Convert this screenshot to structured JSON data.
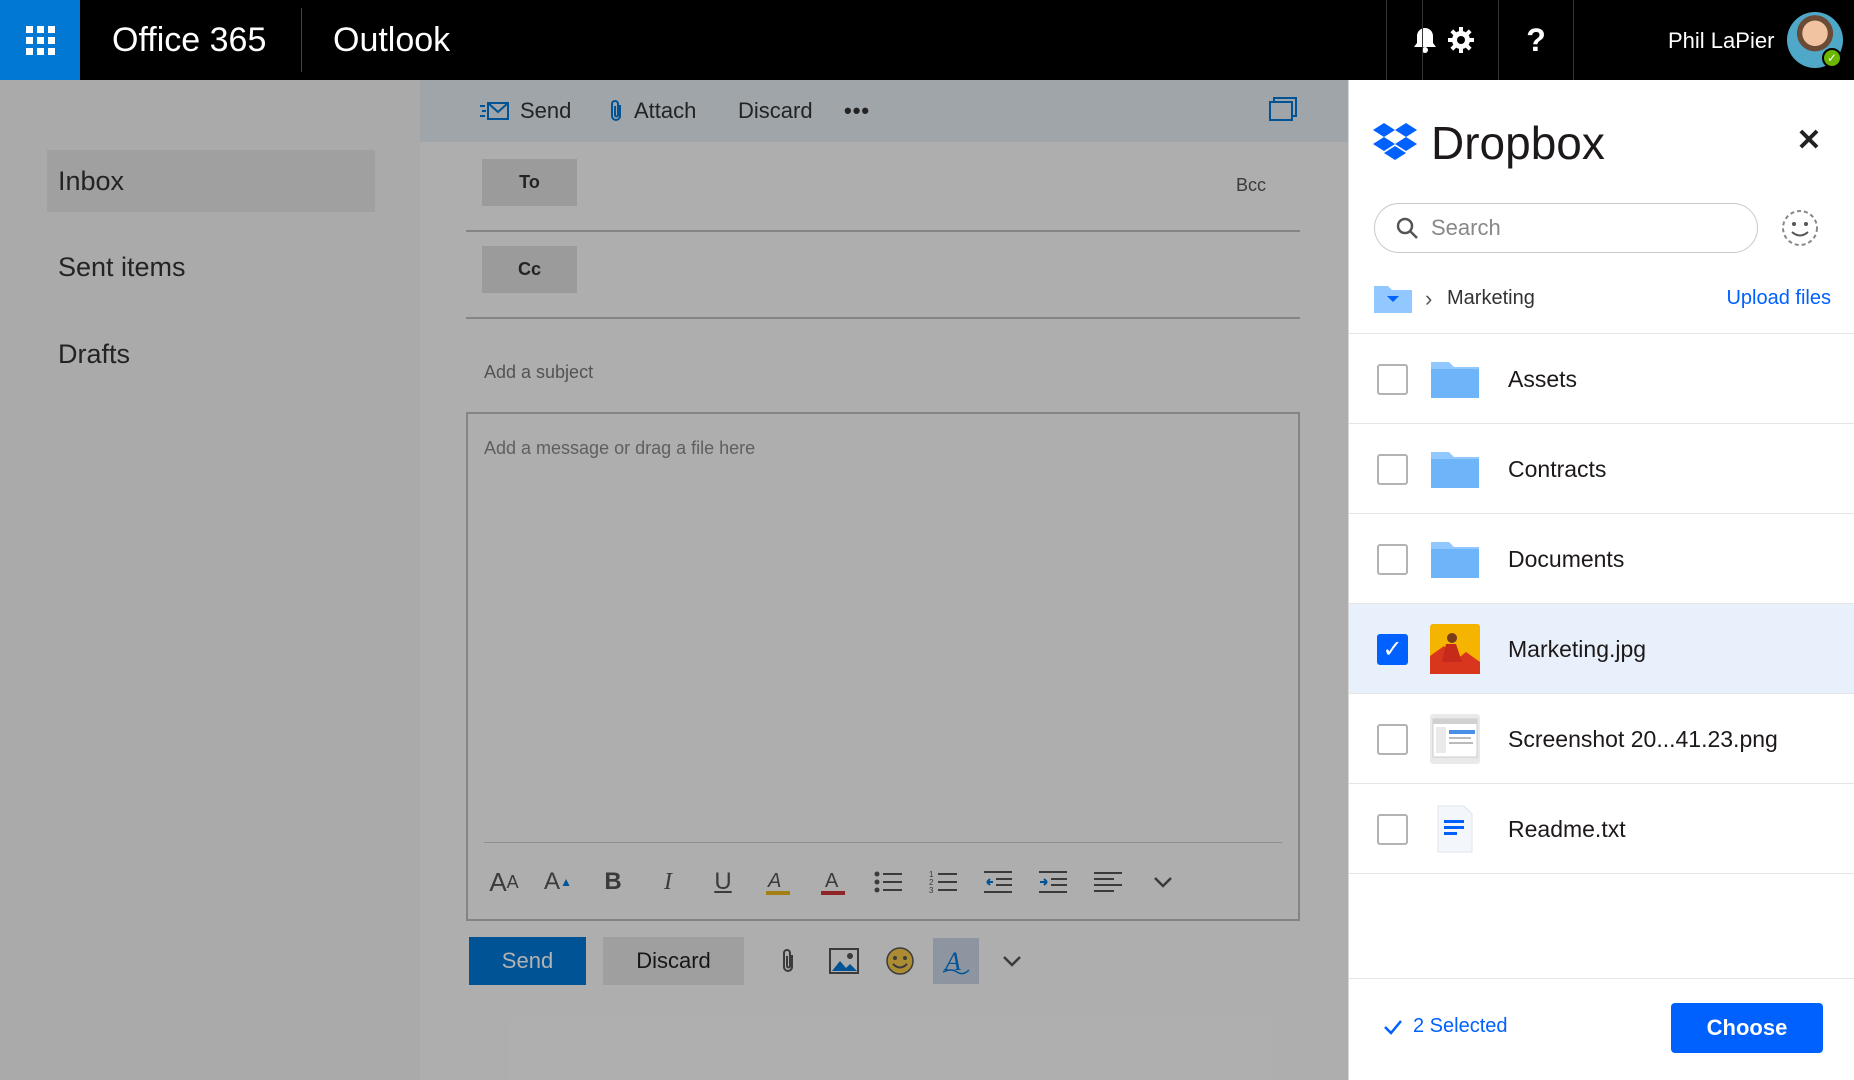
{
  "topbar": {
    "brand": "Office 365",
    "app": "Outlook",
    "user_name": "Phil LaPier",
    "icons": [
      "app-launcher-icon",
      "bell-icon",
      "gear-icon",
      "help-icon"
    ]
  },
  "nav": {
    "items": [
      {
        "label": "Inbox",
        "active": true
      },
      {
        "label": "Sent items",
        "active": false
      },
      {
        "label": "Drafts",
        "active": false
      }
    ]
  },
  "compose": {
    "toolbar": {
      "send": "Send",
      "attach": "Attach",
      "discard": "Discard",
      "more": "•••"
    },
    "to_label": "To",
    "cc_label": "Cc",
    "bcc_label": "Bcc",
    "subject_placeholder": "Add a subject",
    "body_placeholder": "Add a message or drag a file here",
    "send_button": "Send",
    "discard_button": "Discard"
  },
  "dropbox": {
    "title": "Dropbox",
    "search_placeholder": "Search",
    "breadcrumb": "Marketing",
    "upload_label": "Upload files",
    "files": [
      {
        "name": "Assets",
        "kind": "folder",
        "checked": false
      },
      {
        "name": "Contracts",
        "kind": "folder",
        "checked": false
      },
      {
        "name": "Documents",
        "kind": "folder",
        "checked": false
      },
      {
        "name": "Marketing.jpg",
        "kind": "image",
        "checked": true
      },
      {
        "name": "Screenshot 20...41.23.png",
        "kind": "screenshot",
        "checked": false
      },
      {
        "name": "Readme.txt",
        "kind": "text",
        "checked": false
      }
    ],
    "selected_label": "2 Selected",
    "choose_label": "Choose"
  },
  "colors": {
    "office_blue": "#0078d4",
    "dropbox_blue": "#0061fe",
    "topbar": "#000000"
  }
}
